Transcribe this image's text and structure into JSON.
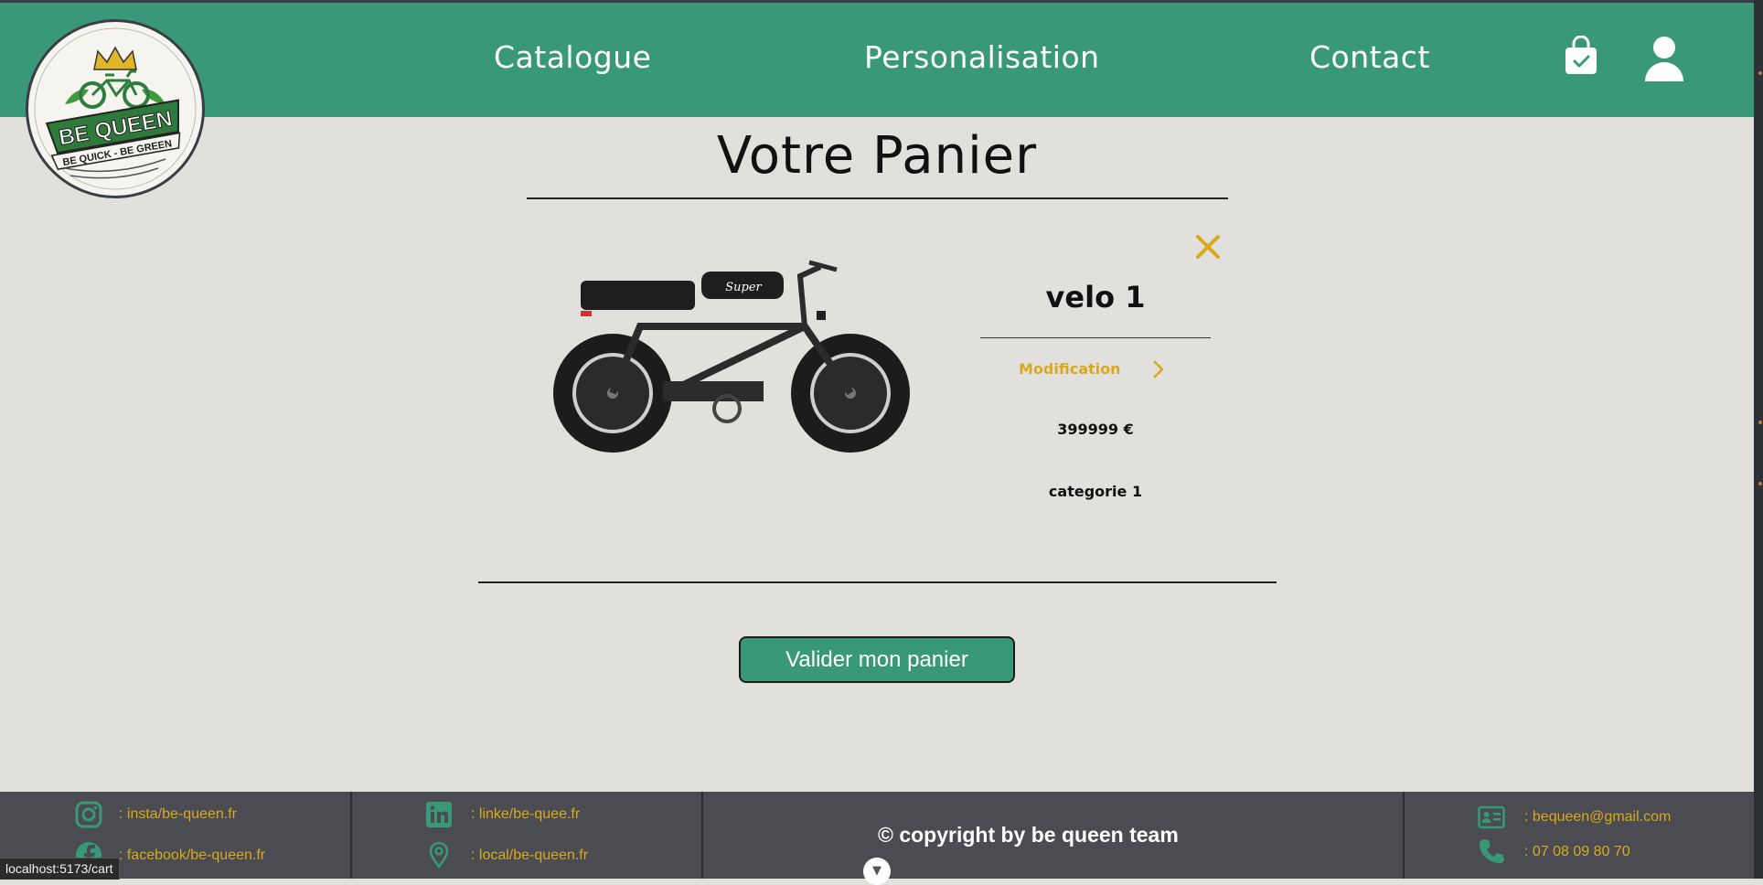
{
  "nav": {
    "catalogue": "Catalogue",
    "personalisation": "Personalisation",
    "contact": "Contact",
    "cart_icon": "shopping-bag-check-icon",
    "user_icon": "user-icon"
  },
  "logo": {
    "name": "BE QUEEN",
    "tagline": "BE QUICK - BE GREEN"
  },
  "cart": {
    "title": "Votre Panier",
    "items": [
      {
        "name": "velo 1",
        "modification_label": "Modification",
        "price": "399999 €",
        "category": "categorie 1"
      }
    ],
    "validate_label": "Valider mon panier"
  },
  "footer": {
    "instagram": ": insta/be-queen.fr",
    "facebook": ": facebook/be-queen.fr",
    "linkedin": ": linke/be-quee.fr",
    "location": ": local/be-queen.fr",
    "copyright": "© copyright by be queen team",
    "email": ": bequeen@gmail.com",
    "phone": ": 07 08 09 80 70"
  },
  "status_bar": {
    "url": "localhost:5173/cart"
  },
  "colors": {
    "brand_green": "#399878",
    "accent_yellow": "#d8a91c",
    "background": "#e1e0dc",
    "footer_bg": "#4a4c51"
  }
}
